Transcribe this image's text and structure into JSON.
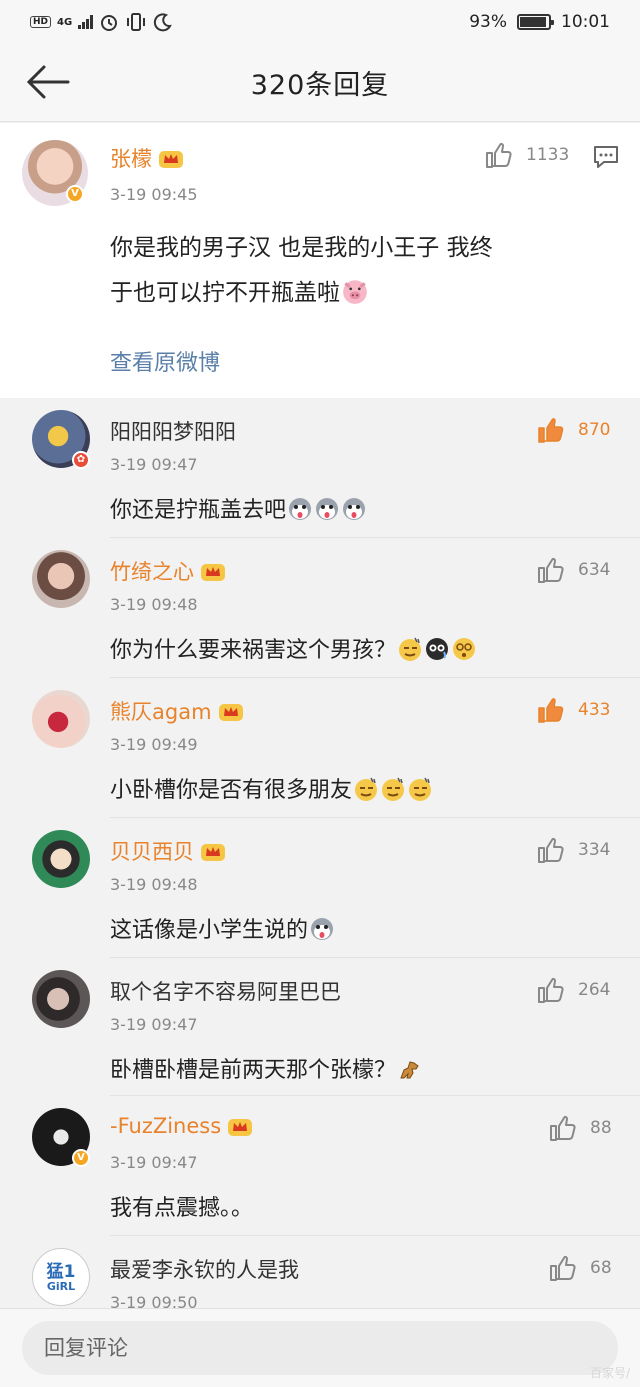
{
  "status_bar": {
    "hd": "HD",
    "network": "4G",
    "battery_percent": "93%",
    "battery_level": 0.93,
    "time": "10:01"
  },
  "nav": {
    "title": "320条回复"
  },
  "main_comment": {
    "username": "张檬",
    "time": "3-19 09:45",
    "likes": "1133",
    "text_line1": "你是我的男子汉  也是我的小王子  我终",
    "text_line2": "于也可以拧不开瓶盖啦",
    "view_original": "查看原微博"
  },
  "replies": [
    {
      "username": "阳阳阳梦阳阳",
      "vip": false,
      "time": "3-19 09:47",
      "likes": "870",
      "hot": true,
      "text": "你还是拧瓶盖去吧",
      "emojis": [
        "husky-emoji",
        "husky-emoji",
        "husky-emoji"
      ]
    },
    {
      "username": "竹绮之心",
      "vip": true,
      "time": "3-19 09:48",
      "likes": "634",
      "hot": false,
      "text": "你为什么要来祸害这个男孩？",
      "emojis": [
        "sweat-emoji",
        "cry-emoji",
        "dizzy-emoji"
      ]
    },
    {
      "username": "熊仄agam",
      "vip": true,
      "time": "3-19 09:49",
      "likes": "433",
      "hot": true,
      "text": "小卧槽你是否有很多朋友",
      "emojis": [
        "sweat-emoji",
        "sweat-emoji",
        "sweat-emoji"
      ]
    },
    {
      "username": "贝贝西贝",
      "vip": true,
      "time": "3-19 09:48",
      "likes": "334",
      "hot": false,
      "text": "这话像是小学生说的",
      "emojis": [
        "husky-emoji"
      ]
    },
    {
      "username": "取个名字不容易阿里巴巴",
      "vip": false,
      "time": "3-19 09:47",
      "likes": "264",
      "hot": false,
      "text": "卧槽卧槽是前两天那个张檬？",
      "emojis": [
        "horse-emoji"
      ]
    },
    {
      "username": "-FuzZiness",
      "vip": true,
      "time": "3-19 09:47",
      "likes": "88",
      "hot": false,
      "text": "我有点震撼。。",
      "emojis": []
    },
    {
      "username": "最爱李永钦的人是我",
      "vip": false,
      "time": "3-19 09:50",
      "likes": "68",
      "hot": false,
      "text": "",
      "emojis": []
    }
  ],
  "avatar_7_text": "猛1",
  "avatar_7_sub": "GiRL",
  "bottom": {
    "placeholder": "回复评论"
  },
  "watermark": "百家号/"
}
